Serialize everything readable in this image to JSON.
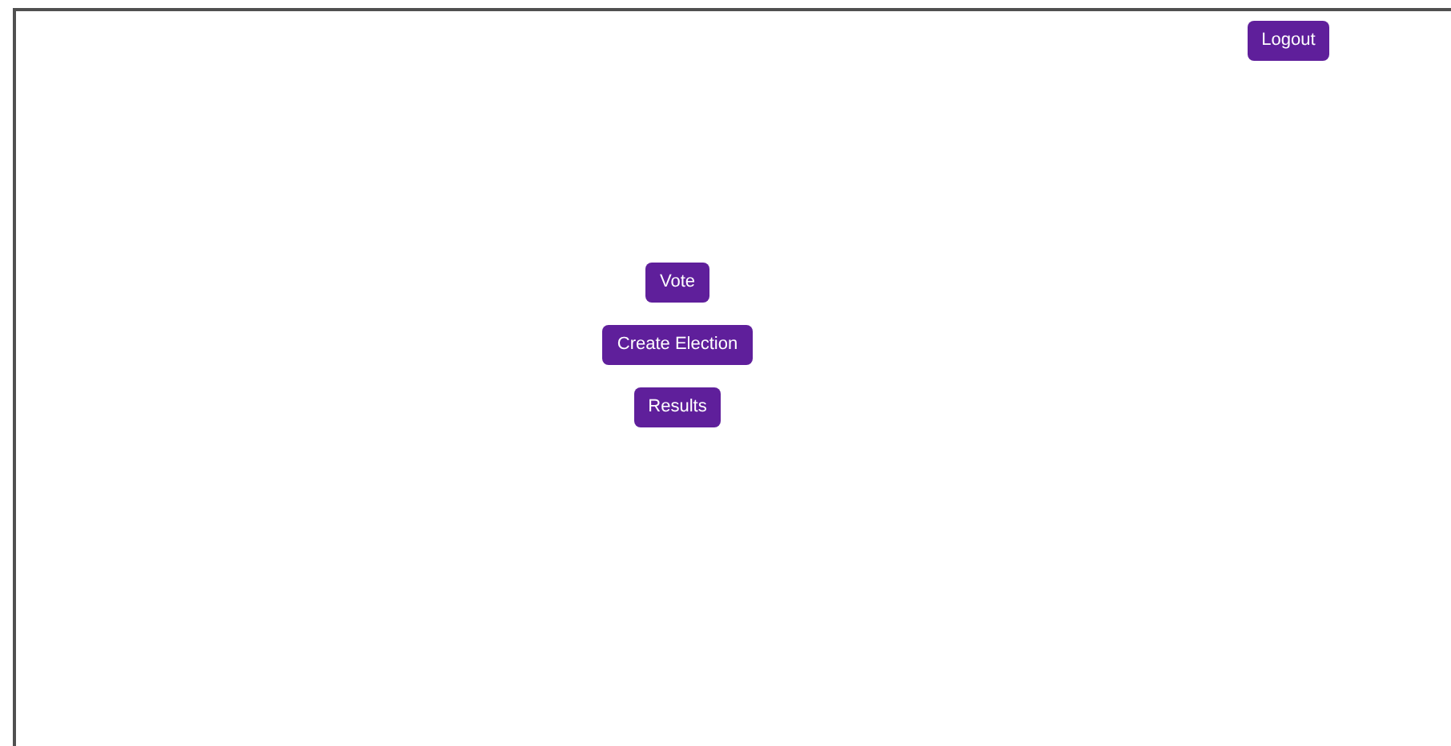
{
  "header": {
    "logout_button": "Logout"
  },
  "menu_buttons": [
    "Vote",
    "Create Election",
    "Results"
  ]
}
